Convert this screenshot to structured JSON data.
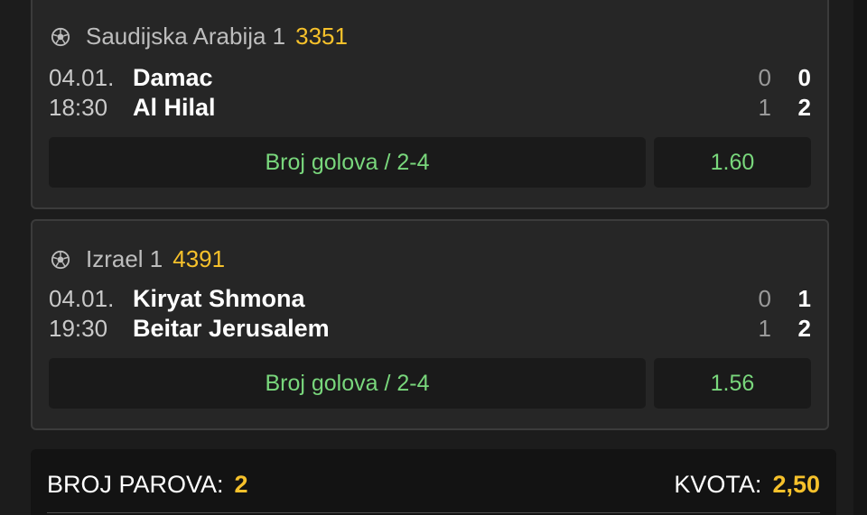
{
  "tickets": [
    {
      "league": "Saudijska Arabija 1",
      "code": "3351",
      "date": "04.01.",
      "time": "18:30",
      "home_team": "Damac",
      "away_team": "Al Hilal",
      "home_ht": "0",
      "home_ft": "0",
      "away_ht": "1",
      "away_ft": "2",
      "pick": "Broj golova / 2-4",
      "odd": "1.60"
    },
    {
      "league": "Izrael 1",
      "code": "4391",
      "date": "04.01.",
      "time": "19:30",
      "home_team": "Kiryat Shmona",
      "away_team": "Beitar Jerusalem",
      "home_ht": "0",
      "home_ft": "1",
      "away_ht": "1",
      "away_ft": "2",
      "pick": "Broj golova / 2-4",
      "odd": "1.56"
    }
  ],
  "summary": {
    "pairs_label": "BROJ PAROVA:",
    "pairs_value": "2",
    "odds_label": "KVOTA:",
    "odds_value": "2,50"
  },
  "colors": {
    "accent_yellow": "#f6c12b",
    "pick_green": "#79d77c",
    "card_bg": "#262626"
  },
  "icons": {
    "league": "soccer-ball-icon"
  }
}
